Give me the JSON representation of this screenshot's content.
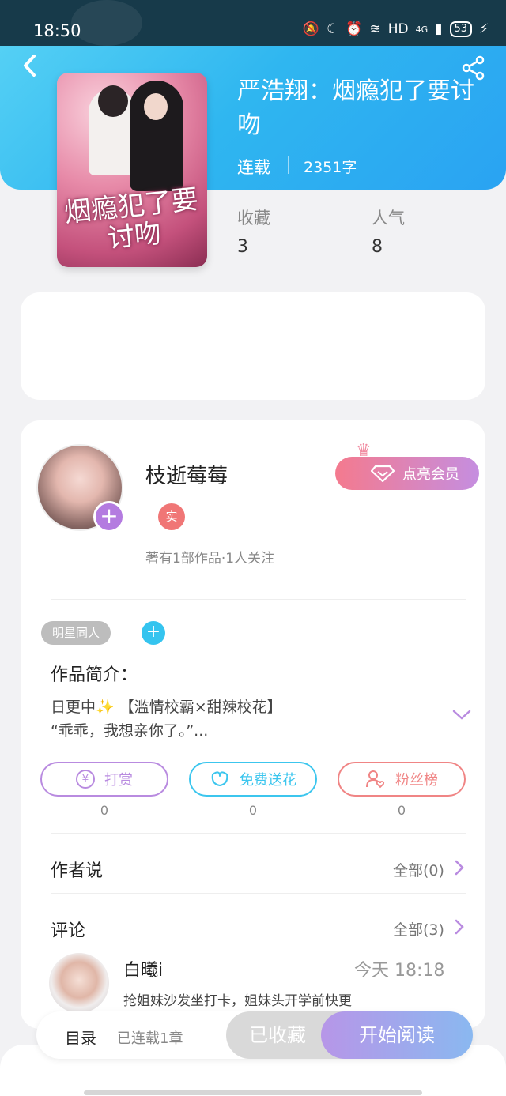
{
  "status_bar": {
    "time": "18:50",
    "network": "HD",
    "signal": "4G",
    "battery": "53"
  },
  "book": {
    "title": "严浩翔：烟瘾犯了要讨吻",
    "cover_text": "烟瘾犯了要讨吻",
    "status": "连载",
    "word_count": "2351字",
    "stats": [
      {
        "label": "收藏",
        "value": "3"
      },
      {
        "label": "人气",
        "value": "8"
      }
    ]
  },
  "author": {
    "name": "枝逝莓莓",
    "badge": "实",
    "meta": "著有1部作品·1人关注",
    "vip_button": "点亮会员"
  },
  "tag": "明星同人",
  "intro": {
    "title": "作品简介：",
    "line1": "日更中✨ 【滥情校霸×甜辣校花】",
    "line2": "“乖乖，我想亲你了。”..."
  },
  "actions": [
    {
      "label": "打赏",
      "count": "0",
      "color": "#b98be0"
    },
    {
      "label": "免费送花",
      "count": "0",
      "color": "#3cc6ee"
    },
    {
      "label": "粉丝榜",
      "count": "0",
      "color": "#f08585"
    }
  ],
  "author_says": {
    "title": "作者说",
    "link": "全部(0)"
  },
  "comments": {
    "title": "评论",
    "link": "全部(3)",
    "items": [
      {
        "name": "白曦i",
        "time": "今天 18:18",
        "text": "抢姐妹沙发坐打卡，姐妹头开学前快更"
      }
    ]
  },
  "bottom_bar": {
    "toc": "目录",
    "toc_count": "已连载1章",
    "collected": "已收藏",
    "read": "开始阅读"
  }
}
